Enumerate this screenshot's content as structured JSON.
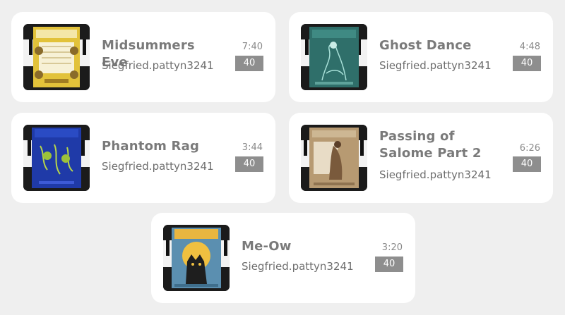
{
  "tracks": [
    {
      "title": "Midsummers Eve",
      "author": "Siegfried.pattyn3241",
      "duration": "7:40",
      "badge": "40",
      "cover_icon": "sheet-music-cover-yellow",
      "cover_color": "#e2c23a"
    },
    {
      "title": "Ghost Dance",
      "author": "Siegfried.pattyn3241",
      "duration": "4:48",
      "badge": "40",
      "cover_icon": "sheet-music-cover-teal",
      "cover_color": "#2f6f6a"
    },
    {
      "title": "Phantom Rag",
      "author": "Siegfried.pattyn3241",
      "duration": "3:44",
      "badge": "40",
      "cover_icon": "sheet-music-cover-blue",
      "cover_color": "#1f3aa8"
    },
    {
      "title": "Passing of Salome Part 2",
      "author": "Siegfried.pattyn3241",
      "duration": "6:26",
      "badge": "40",
      "cover_icon": "sheet-music-cover-sepia",
      "cover_color": "#b79a72"
    },
    {
      "title": "Me-Ow",
      "author": "Siegfried.pattyn3241",
      "duration": "3:20",
      "badge": "40",
      "cover_icon": "sheet-music-cover-cat",
      "cover_color": "#5b8fb0"
    }
  ]
}
